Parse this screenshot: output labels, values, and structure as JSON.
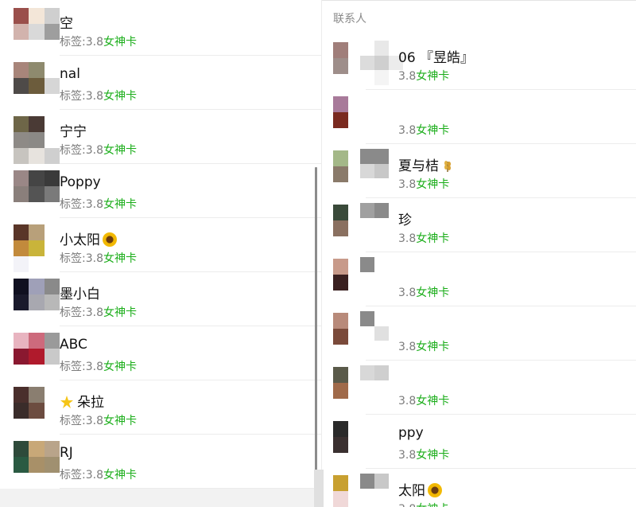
{
  "colors": {
    "accent": "#1aad19",
    "label": "#7c7c7c",
    "divider": "#ececec"
  },
  "tag_prefix": "标签:",
  "tag_value": "3.8",
  "tag_accent": "女神卡",
  "left": {
    "contacts": [
      {
        "name": "空",
        "avatar": [
          "#9a4f4b",
          "#f3e6d8",
          "#cfcfcf",
          "#d2b3ad",
          "#d9d9d9",
          "#9e9e9e",
          "#ffffff",
          "#ffffff",
          "#ffffff"
        ]
      },
      {
        "name": "nal",
        "avatar": [
          "#a8857a",
          "#8e8a6e",
          "#ffffff",
          "#4e4a48",
          "#6c5c3c",
          "#d6d6d6",
          "#ffffff",
          "#ffffff",
          "#ffffff"
        ]
      },
      {
        "name": "宁宁",
        "avatar": [
          "#6e6648",
          "#4a3a35",
          "#ffffff",
          "#8e8a86",
          "#8b8986",
          "#ffffff",
          "#c7c4bf",
          "#e7e3de",
          "#cfcfcf"
        ]
      },
      {
        "name": "Poppy",
        "avatar": [
          "#9a8786",
          "#454545",
          "#3a3a3a",
          "#8a7f7b",
          "#545454",
          "#7a7a7a",
          "#ffffff",
          "#ffffff",
          "#ffffff"
        ]
      },
      {
        "name": "小太阳",
        "emoji": "sun",
        "avatar": [
          "#5a3628",
          "#b8a07a",
          "#ffffff",
          "#c28a3c",
          "#c9b43a",
          "#ffffff",
          "#f3f3f8",
          "#ffffff",
          "#ffffff"
        ]
      },
      {
        "name": "墨小白",
        "avatar": [
          "#101020",
          "#9fa0b8",
          "#8a8a8a",
          "#1a1a2c",
          "#a8a8b0",
          "#b8b8b8",
          "#ffffff",
          "#ffffff",
          "#ffffff"
        ]
      },
      {
        "name": "ABC",
        "avatar": [
          "#e8b4c0",
          "#cd6a7c",
          "#9a9a9a",
          "#8a1830",
          "#b01a2c",
          "#c9c9c9",
          "#ffffff",
          "#ffffff",
          "#ffffff"
        ]
      },
      {
        "name": "朵拉",
        "emoji": "star",
        "avatar": [
          "#4a2f2c",
          "#8a7e70",
          "#ffffff",
          "#3a2c2a",
          "#6c4c40",
          "#ffffff",
          "#ffffff",
          "#ffffff",
          "#ffffff"
        ]
      },
      {
        "name": "RJ",
        "avatar": [
          "#2e4a3a",
          "#c8a878",
          "#b9a48a",
          "#2a5a42",
          "#a89068",
          "#a09070",
          "#ffffff",
          "#ffffff",
          "#ffffff"
        ]
      }
    ]
  },
  "right": {
    "header": "联系人",
    "contacts": [
      {
        "name": "06 『昱皓』",
        "avatar": [
          "#a07e7a",
          "#ffffff",
          "#ffffff",
          "#9e8e8a",
          "#ffffff",
          "#ffffff",
          "#ffffff",
          "#ffffff",
          "#ffffff"
        ],
        "blur": [
          "#ffffff",
          "#e8e8e8",
          "#ffffff",
          "#dcdcdc",
          "#cfcfcf",
          "#ececec",
          "#ffffff",
          "#f4f4f4",
          "#ffffff"
        ]
      },
      {
        "name": "",
        "avatar": [
          "#a87a9a",
          "#ffffff",
          "#ffffff",
          "#7a2a20",
          "#ffffff",
          "#ffffff",
          "#ffffff",
          "#ffffff",
          "#ffffff"
        ],
        "blur": [
          "#ffffff",
          "#ffffff",
          "#ffffff",
          "#ffffff",
          "#ffffff",
          "#ffffff",
          "#ffffff",
          "#ffffff",
          "#ffffff"
        ]
      },
      {
        "name": "夏与桔",
        "emoji": "wheat",
        "avatar": [
          "#a4b888",
          "#ffffff",
          "#ffffff",
          "#8a7a6a",
          "#ffffff",
          "#ffffff",
          "#ffffff",
          "#ffffff",
          "#ffffff"
        ],
        "blur": [
          "#8a8a8a",
          "#8a8a8a",
          "#ffffff",
          "#d8d8d8",
          "#c8c8c8",
          "#ffffff",
          "#ffffff",
          "#ffffff",
          "#ffffff"
        ]
      },
      {
        "name": "珍",
        "avatar": [
          "#3a4a3a",
          "#ffffff",
          "#ffffff",
          "#8a7060",
          "#ffffff",
          "#ffffff",
          "#ffffff",
          "#ffffff",
          "#ffffff"
        ],
        "blur": [
          "#a0a0a0",
          "#8a8a8a",
          "#ffffff",
          "#ffffff",
          "#ffffff",
          "#ffffff",
          "#ffffff",
          "#ffffff",
          "#ffffff"
        ]
      },
      {
        "name": "",
        "avatar": [
          "#c89a8a",
          "#ffffff",
          "#ffffff",
          "#3a2020",
          "#ffffff",
          "#ffffff",
          "#ffffff",
          "#ffffff",
          "#ffffff"
        ],
        "blur": [
          "#8a8a8a",
          "#ffffff",
          "#ffffff",
          "#ffffff",
          "#ffffff",
          "#ffffff",
          "#ffffff",
          "#ffffff",
          "#ffffff"
        ]
      },
      {
        "name": "",
        "avatar": [
          "#b88a7a",
          "#ffffff",
          "#ffffff",
          "#7a4a3a",
          "#ffffff",
          "#ffffff",
          "#ffffff",
          "#ffffff",
          "#ffffff"
        ],
        "blur": [
          "#8a8a8a",
          "#ffffff",
          "#ffffff",
          "#ffffff",
          "#e0e0e0",
          "#ffffff",
          "#ffffff",
          "#ffffff",
          "#ffffff"
        ]
      },
      {
        "name": "",
        "avatar": [
          "#5a5a4a",
          "#ffffff",
          "#ffffff",
          "#a06a4a",
          "#ffffff",
          "#ffffff",
          "#ffffff",
          "#ffffff",
          "#ffffff"
        ],
        "blur": [
          "#d8d8d8",
          "#cfcfcf",
          "#ffffff",
          "#ffffff",
          "#ffffff",
          "#ffffff",
          "#ffffff",
          "#ffffff",
          "#ffffff"
        ]
      },
      {
        "name": "ppy",
        "avatar": [
          "#2a2a2a",
          "#ffffff",
          "#ffffff",
          "#3a3030",
          "#ffffff",
          "#ffffff",
          "#ffffff",
          "#ffffff",
          "#ffffff"
        ],
        "blur": [
          "#ffffff",
          "#ffffff",
          "#ffffff",
          "#ffffff",
          "#ffffff",
          "#ffffff",
          "#ffffff",
          "#ffffff",
          "#ffffff"
        ]
      },
      {
        "name": "太阳",
        "emoji": "sun",
        "avatar": [
          "#c8a030",
          "#ffffff",
          "#ffffff",
          "#f0d8d8",
          "#ffffff",
          "#ffffff",
          "#ffffff",
          "#ffffff",
          "#ffffff"
        ],
        "blur": [
          "#8a8a8a",
          "#c8c8c8",
          "#ffffff",
          "#ffffff",
          "#ffffff",
          "#ffffff",
          "#ffffff",
          "#ffffff",
          "#ffffff"
        ]
      }
    ]
  }
}
